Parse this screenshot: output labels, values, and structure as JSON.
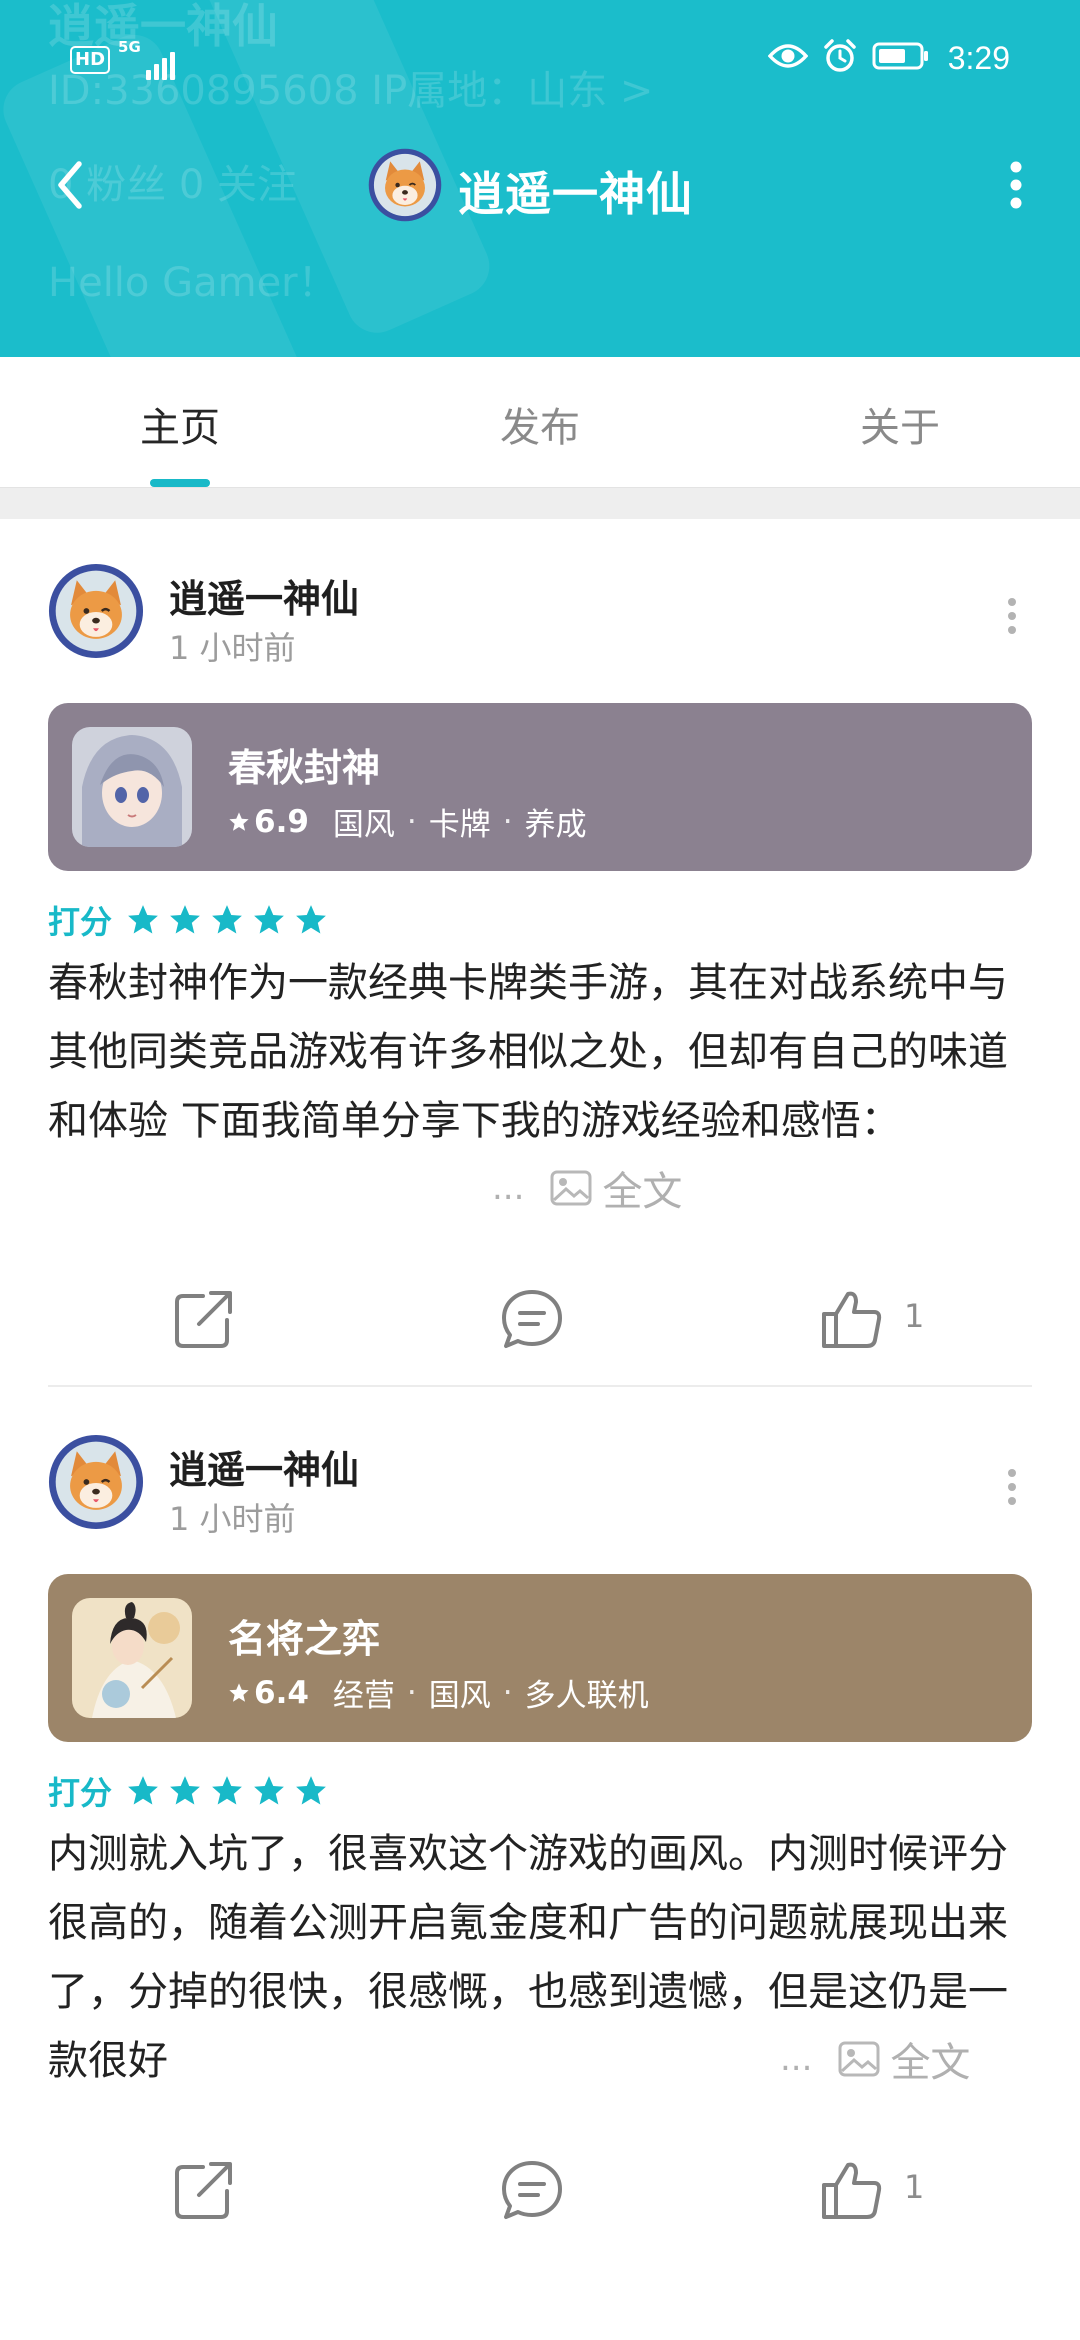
{
  "status_bar": {
    "hd": "HD",
    "network": "5G",
    "time": "3:29"
  },
  "header": {
    "title": "逍遥一神仙",
    "background_color": "#1bbdcb",
    "ghost_text": {
      "name": "逍遥一神仙",
      "id_location": "ID:3360895608    IP属地：山东 >",
      "stats": "0 粉丝    0 关注",
      "bio": "Hello Gamer！"
    }
  },
  "tabs": [
    {
      "label": "主页",
      "active": true
    },
    {
      "label": "发布",
      "active": false
    },
    {
      "label": "关于",
      "active": false
    }
  ],
  "accent_color": "#18b9c8",
  "posts": [
    {
      "author": "逍遥一神仙",
      "time": "1 小时前",
      "game": {
        "name": "春秋封神",
        "score": "6.9",
        "tags": [
          "国风",
          "卡牌",
          "养成"
        ],
        "card_color": "#8b8190"
      },
      "rating_label": "打分",
      "stars": 5,
      "review": "春秋封神作为一款经典卡牌类手游，其在对战系统中与其他同类竞品游戏有许多相似之处，但却有自己的味道和体验 下面我简单分享下我的游戏经验和感悟：",
      "ellipsis": "...",
      "full_text_label": "全文",
      "likes": "1"
    },
    {
      "author": "逍遥一神仙",
      "time": "1 小时前",
      "game": {
        "name": "名将之弈",
        "score": "6.4",
        "tags": [
          "经营",
          "国风",
          "多人联机"
        ],
        "card_color": "#9c8569"
      },
      "rating_label": "打分",
      "stars": 5,
      "review": "内测就入坑了，很喜欢这个游戏的画风。内测时候评分很高的，随着公测开启氪金度和广告的问题就展现出来了，分掉的很快，很感慨，也感到遗憾，但是这仍是一款很好",
      "ellipsis": "...",
      "full_text_label": "全文",
      "likes": "1"
    }
  ]
}
